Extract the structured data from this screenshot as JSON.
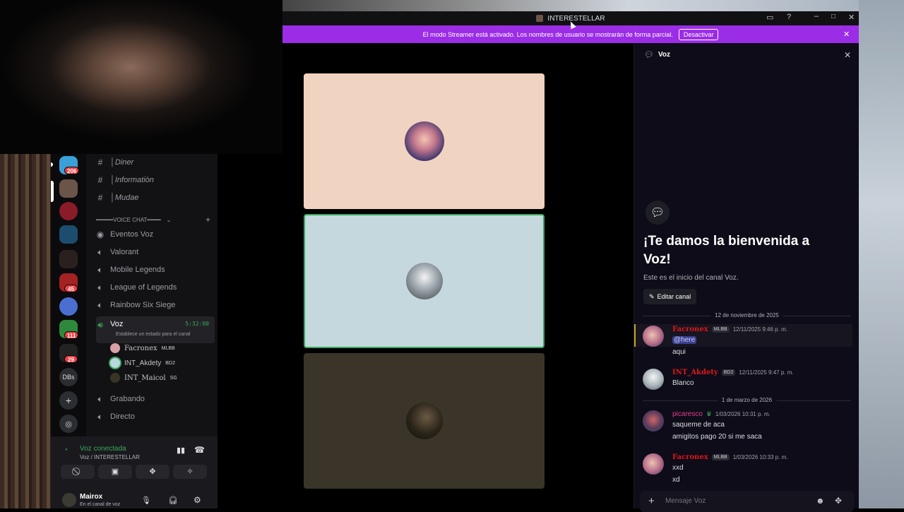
{
  "window": {
    "title": "INTERESTELLAR",
    "controls": [
      "inbox-icon",
      "help-icon",
      "minimize-icon",
      "maximize-icon",
      "close-icon"
    ]
  },
  "streamer_banner": {
    "text": "El modo Streamer está activado. Los nombres de usuario se mostrarán de forma parcial.",
    "button": "Desactivar"
  },
  "sidebar": {
    "channels_text": [
      {
        "icon": "hash-icon",
        "label": "│Diner"
      },
      {
        "icon": "hash-icon",
        "label": "│Informatiòn"
      },
      {
        "icon": "hash-icon",
        "label": "│Mudae"
      }
    ],
    "category": "━━━━━VOICE CHAT━━━━",
    "voice_channels": [
      {
        "icon": "broadcast-icon",
        "label": "Eventos Voz"
      },
      {
        "icon": "speaker-icon",
        "label": "Valorant"
      },
      {
        "icon": "speaker-icon",
        "label": "Mobile Legends"
      },
      {
        "icon": "speaker-icon",
        "label": "League of Legends"
      },
      {
        "icon": "speaker-icon",
        "label": "Rainbow Six Siege"
      }
    ],
    "active_channel": {
      "label": "Voz",
      "timer": "5:32:00",
      "status_hint": "Establece un estado para el canal"
    },
    "members": [
      {
        "name": "Facronex",
        "tag": "MLBB",
        "color": "#d9a0a8"
      },
      {
        "name": "INT_Akdety",
        "tag": "BD2",
        "color": "#b9d7e0"
      },
      {
        "name": "INT_Maicol",
        "tag": "SG",
        "color": "#3a3426"
      }
    ],
    "more_channels": [
      {
        "icon": "speaker-icon",
        "label": "Grabando"
      },
      {
        "icon": "speaker-icon",
        "label": "Directo"
      }
    ],
    "servers": {
      "badges": [
        "206",
        "45",
        "111",
        "29"
      ],
      "text_server": "DBs"
    },
    "voice_panel": {
      "status": "Voz conectada",
      "location": "Voz / INTERESTELLAR"
    },
    "user": {
      "name": "Mairox",
      "status": "En el canal de voz"
    }
  },
  "video_tiles": [
    {
      "bg": "#f1d3c1",
      "avatar": "#5a4a7a"
    },
    {
      "bg": "#c5d8de",
      "avatar": "#9aa4aa"
    },
    {
      "bg": "#3a3528",
      "avatar": "#4a4030"
    }
  ],
  "chat": {
    "header": "Voz",
    "welcome_title": "¡Te damos la bienvenida a Voz!",
    "welcome_sub": "Este es el inicio del canal Voz.",
    "edit_button": "Editar canal",
    "dividers": [
      "12 de noviembre de 2025",
      "1 de marzo de 2026"
    ],
    "messages": [
      {
        "user": "Facronex",
        "tag": "MLBB",
        "time": "12/11/2025 9:46 p. m.",
        "lines": [
          "@here",
          "aqui"
        ],
        "user_color": "#e0161b"
      },
      {
        "user": "INT_Akdety",
        "tag": "BD2",
        "time": "12/11/2025 9:47 p. m.",
        "lines": [
          "Blanco"
        ],
        "user_color": "#e0161b"
      },
      {
        "user": "picaresco",
        "tag": "",
        "time": "1/03/2026 10:31 p. m.",
        "lines": [
          "saqueme de aca",
          "amigitos pago 20 si me saca"
        ],
        "user_color": "#e43a8e"
      },
      {
        "user": "Facronex",
        "tag": "MLBB",
        "time": "1/03/2026 10:33 p. m.",
        "lines": [
          "xxd",
          "xd"
        ],
        "user_color": "#e0161b"
      }
    ],
    "input_placeholder": "Mensaje Voz"
  },
  "colors": {
    "streamer_banner": "#9b2de6",
    "mention_bg": "#3c3f8f",
    "speaking_border": "#3ba55c"
  }
}
